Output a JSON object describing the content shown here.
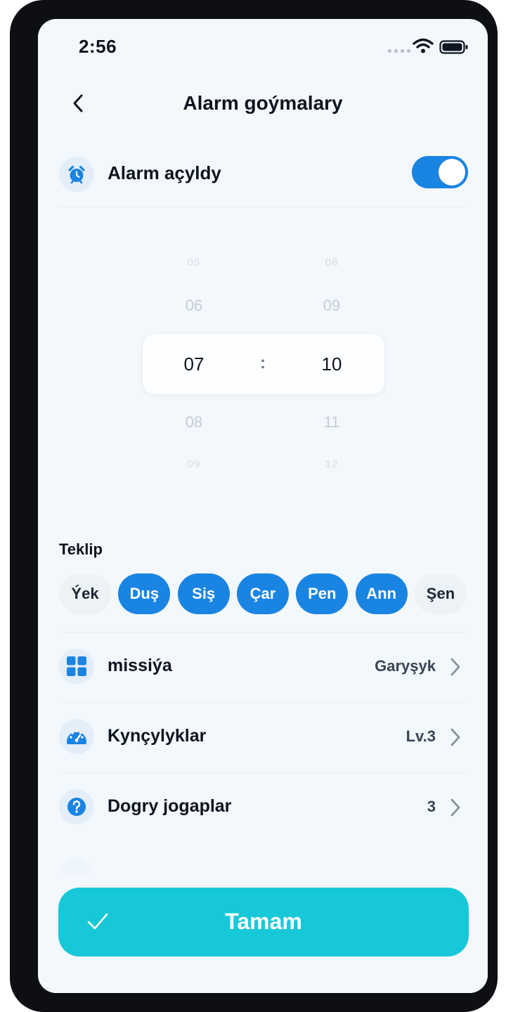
{
  "status_bar": {
    "time": "2:56"
  },
  "header": {
    "title": "Alarm goýmalary"
  },
  "alarm": {
    "label": "Alarm açyldy",
    "enabled": true
  },
  "time_picker": {
    "hours": {
      "far_above": "05",
      "above": "06",
      "selected": "07",
      "below": "08",
      "far_below": "09"
    },
    "minutes": {
      "far_above": "08",
      "above": "09",
      "selected": "10",
      "below": "11",
      "far_below": "12"
    },
    "separator": ":"
  },
  "repeat": {
    "label": "Teklip",
    "days": [
      {
        "label": "Ýek",
        "selected": false
      },
      {
        "label": "Duş",
        "selected": true
      },
      {
        "label": "Siş",
        "selected": true
      },
      {
        "label": "Çar",
        "selected": true
      },
      {
        "label": "Pen",
        "selected": true
      },
      {
        "label": "Ann",
        "selected": true
      },
      {
        "label": "Şen",
        "selected": false
      }
    ]
  },
  "settings": [
    {
      "icon": "grid-icon",
      "label": "missiýa",
      "value": "Garyşyk"
    },
    {
      "icon": "speedometer-icon",
      "label": "Kynçylyklar",
      "value": "Lv.3"
    },
    {
      "icon": "question-icon",
      "label": "Dogry jogaplar",
      "value": "3"
    }
  ],
  "confirm_button": {
    "label": "Tamam",
    "icon": "check-icon"
  },
  "colors": {
    "accent": "#1a84e2",
    "confirm": "#17c8d9",
    "background": "#f3f8fc"
  }
}
